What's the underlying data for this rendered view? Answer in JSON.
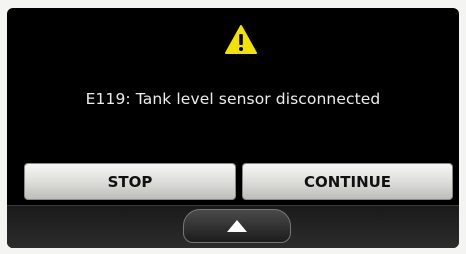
{
  "dialog": {
    "icon": "warning-icon",
    "message": "E119: Tank level sensor disconnected",
    "stop_label": "STOP",
    "continue_label": "CONTINUE"
  },
  "bottom_bar": {
    "expand_icon": "up-arrow-icon"
  },
  "colors": {
    "warning_fill": "#f2e200",
    "background": "#000000",
    "text": "#ececec"
  }
}
